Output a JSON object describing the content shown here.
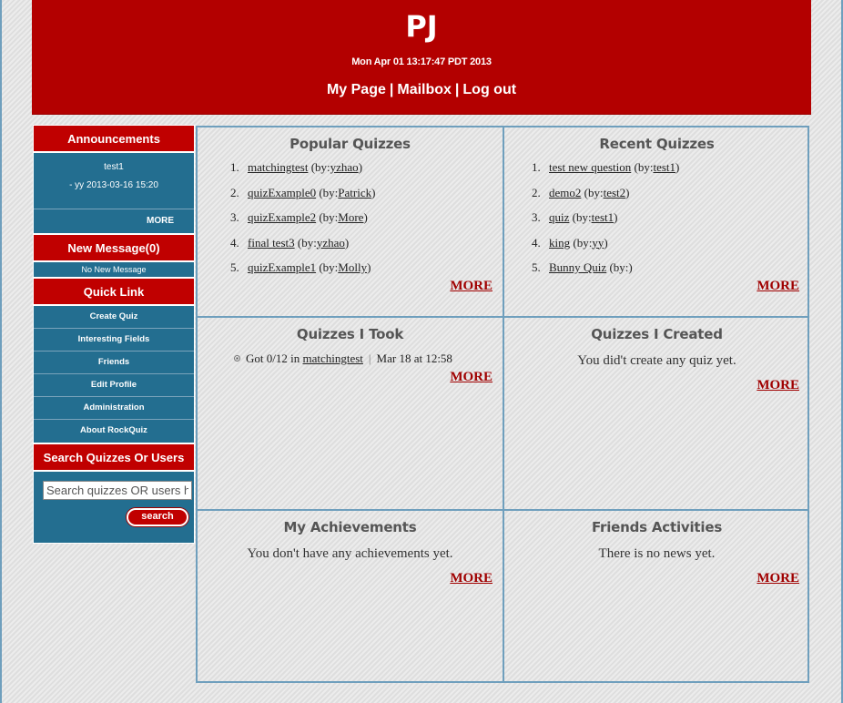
{
  "header": {
    "title": "PJ",
    "date": "Mon Apr 01 13:17:47 PDT 2013",
    "nav": {
      "my_page": "My Page",
      "separator": "|",
      "mailbox": "Mailbox",
      "logout": "Log out"
    }
  },
  "sidebar": {
    "announcements": {
      "heading": "Announcements",
      "name": "test1",
      "meta": "- yy 2013-03-16 15:20",
      "more": "MORE"
    },
    "messages": {
      "heading": "New Message(0)",
      "status": "No New Message"
    },
    "quick_link": {
      "heading": "Quick Link",
      "items": [
        "Create Quiz",
        "Interesting Fields",
        "Friends",
        "Edit Profile",
        "Administration",
        "About RockQuiz"
      ]
    },
    "search": {
      "heading": "Search Quizzes Or Users",
      "placeholder": "Search quizzes OR users here",
      "button": "search"
    }
  },
  "panels": {
    "popular": {
      "title": "Popular Quizzes",
      "items": [
        {
          "num": "1.",
          "quiz": "matchingtest",
          "by_prefix": "(by:",
          "author": "yzhao",
          "by_suffix": ")"
        },
        {
          "num": "2.",
          "quiz": "quizExample0",
          "by_prefix": "(by:",
          "author": "Patrick",
          "by_suffix": ")"
        },
        {
          "num": "3.",
          "quiz": "quizExample2",
          "by_prefix": "(by:",
          "author": "More",
          "by_suffix": ")"
        },
        {
          "num": "4.",
          "quiz": "final test3",
          "by_prefix": "(by:",
          "author": "yzhao",
          "by_suffix": ")"
        },
        {
          "num": "5.",
          "quiz": "quizExample1",
          "by_prefix": "(by:",
          "author": "Molly",
          "by_suffix": ")"
        }
      ],
      "more": "MORE"
    },
    "recent": {
      "title": "Recent Quizzes",
      "items": [
        {
          "num": "1.",
          "quiz": "test new question",
          "by_prefix": "(by:",
          "author": "test1",
          "by_suffix": ")"
        },
        {
          "num": "2.",
          "quiz": "demo2",
          "by_prefix": "(by:",
          "author": "test2",
          "by_suffix": ")"
        },
        {
          "num": "3.",
          "quiz": "quiz",
          "by_prefix": "(by:",
          "author": "test1",
          "by_suffix": ")"
        },
        {
          "num": "4.",
          "quiz": "king",
          "by_prefix": "(by:",
          "author": "yy",
          "by_suffix": ")"
        },
        {
          "num": "5.",
          "quiz": "Bunny Quiz",
          "by_prefix": "(by:",
          "author": "",
          "by_suffix": ")"
        }
      ],
      "more": "MORE"
    },
    "took": {
      "title": "Quizzes I Took",
      "entry": {
        "score_text": "Got 0/12 in",
        "quiz": "matchingtest",
        "separator": "|",
        "when": "Mar 18 at 12:58"
      },
      "more": "MORE"
    },
    "created": {
      "title": "Quizzes I Created",
      "message": "You did't create any quiz yet.",
      "more": "MORE"
    },
    "achievements": {
      "title": "My Achievements",
      "message": "You don't have any achievements yet.",
      "more": "MORE"
    },
    "friends": {
      "title": "Friends Activities",
      "message": "There is no news yet.",
      "more": "MORE"
    }
  },
  "colors": {
    "brand_red": "#b30000",
    "sidebar_blue": "#236e90",
    "border_blue": "#6f9fbd",
    "more_red": "#a00000"
  }
}
